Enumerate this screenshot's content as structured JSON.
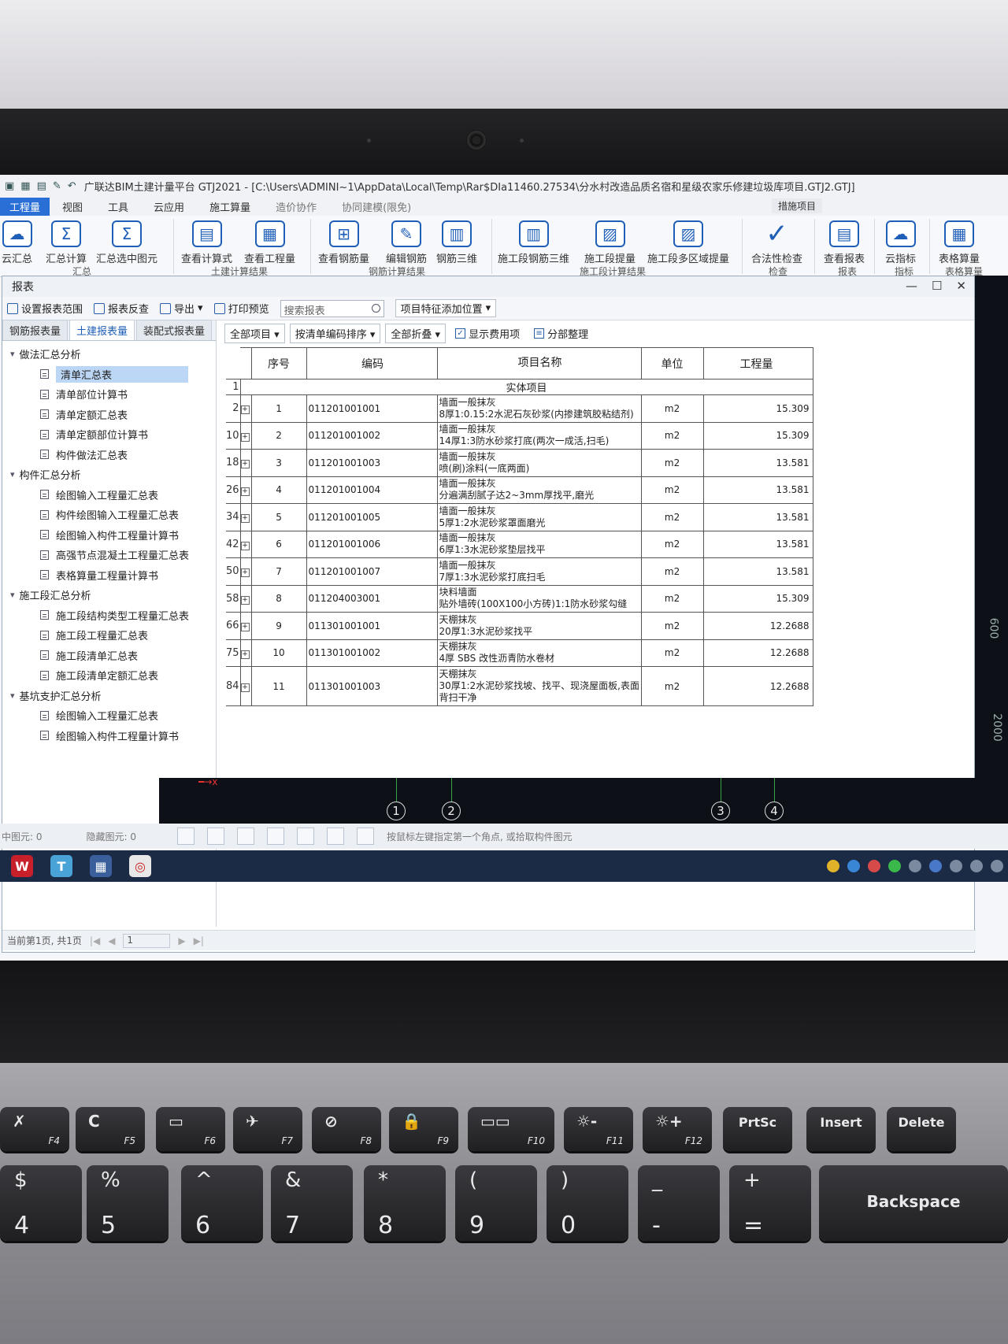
{
  "app": {
    "title": "广联达BIM土建计量平台 GTJ2021 - [C:\\Users\\ADMINI~1\\AppData\\Local\\Temp\\Rar$DIa11460.27534\\分水村改造品质名宿和星级农家乐修建垃圾库项目.GTJ2.GTJ]",
    "context_tab": "措施项目"
  },
  "menu": [
    "工程量",
    "视图",
    "工具",
    "云应用",
    "施工算量",
    "造价协作",
    "协同建模(限免)"
  ],
  "ribbon": {
    "buttons": [
      "云汇总",
      "汇总计算",
      "汇总选中图元",
      "查看计算式",
      "查看工程量",
      "查看钢筋量",
      "编辑钢筋",
      "钢筋三维",
      "施工段钢筋三维",
      "施工段提量",
      "施工段多区域提量",
      "合法性检查",
      "查看报表",
      "云指标",
      "表格算量"
    ],
    "groups": [
      "汇总",
      "土建计算结果",
      "钢筋计算结果",
      "施工段计算结果",
      "检查",
      "报表",
      "指标",
      "表格算量"
    ]
  },
  "report": {
    "title": "报表",
    "toolbar": {
      "set_range": "设置报表范围",
      "recheck": "报表反查",
      "export": "导出",
      "print_preview": "打印预览",
      "search_placeholder": "搜索报表",
      "feature_position": "项目特征添加位置"
    },
    "left_tabs": [
      "钢筋报表量",
      "土建报表量",
      "装配式报表量"
    ],
    "tree": [
      {
        "group": "做法汇总分析",
        "items": [
          "清单汇总表",
          "清单部位计算书",
          "清单定额汇总表",
          "清单定额部位计算书",
          "构件做法汇总表"
        ]
      },
      {
        "group": "构件汇总分析",
        "items": [
          "绘图输入工程量汇总表",
          "构件绘图输入工程量汇总表",
          "绘图输入构件工程量计算书",
          "高强节点混凝土工程量汇总表",
          "表格算量工程量计算书"
        ]
      },
      {
        "group": "施工段汇总分析",
        "items": [
          "施工段结构类型工程量汇总表",
          "施工段工程量汇总表",
          "施工段清单汇总表",
          "施工段清单定额汇总表"
        ]
      },
      {
        "group": "基坑支护汇总分析",
        "items": [
          "绘图输入工程量汇总表",
          "绘图输入构件工程量计算书"
        ]
      }
    ],
    "filter": {
      "scope": "全部项目",
      "sort": "按清单编码排序",
      "fold": "全部折叠",
      "show_fees": "显示费用项",
      "section": "分部整理"
    },
    "table": {
      "headers": [
        "序号",
        "编码",
        "项目名称",
        "单位",
        "工程量"
      ],
      "category_row": {
        "rownum": "1",
        "label": "实体项目"
      },
      "rows": [
        {
          "rownum": "2",
          "seq": "1",
          "code": "011201001001",
          "name1": "墙面一般抹灰",
          "name2": "8厚1:0.15:2水泥石灰砂浆(内掺建筑胶粘结剂)",
          "unit": "m2",
          "qty": "15.309"
        },
        {
          "rownum": "10",
          "seq": "2",
          "code": "011201001002",
          "name1": "墙面一般抹灰",
          "name2": "14厚1:3防水砂浆打底(两次一成活,扫毛)",
          "unit": "m2",
          "qty": "15.309"
        },
        {
          "rownum": "18",
          "seq": "3",
          "code": "011201001003",
          "name1": "墙面一般抹灰",
          "name2": "喷(刷)涂料(一底两面)",
          "unit": "m2",
          "qty": "13.581"
        },
        {
          "rownum": "26",
          "seq": "4",
          "code": "011201001004",
          "name1": "墙面一般抹灰",
          "name2": "分遍满刮腻子达2~3mm厚找平,磨光",
          "unit": "m2",
          "qty": "13.581"
        },
        {
          "rownum": "34",
          "seq": "5",
          "code": "011201001005",
          "name1": "墙面一般抹灰",
          "name2": "5厚1:2水泥砂浆罩面磨光",
          "unit": "m2",
          "qty": "13.581"
        },
        {
          "rownum": "42",
          "seq": "6",
          "code": "011201001006",
          "name1": "墙面一般抹灰",
          "name2": "6厚1:3水泥砂浆垫层找平",
          "unit": "m2",
          "qty": "13.581"
        },
        {
          "rownum": "50",
          "seq": "7",
          "code": "011201001007",
          "name1": "墙面一般抹灰",
          "name2": "7厚1:3水泥砂浆打底扫毛",
          "unit": "m2",
          "qty": "13.581"
        },
        {
          "rownum": "58",
          "seq": "8",
          "code": "011204003001",
          "name1": "块料墙面",
          "name2": "贴外墙砖(100X100小方砖)1:1防水砂浆勾缝",
          "unit": "m2",
          "qty": "15.309"
        },
        {
          "rownum": "66",
          "seq": "9",
          "code": "011301001001",
          "name1": "天棚抹灰",
          "name2": "20厚1:3水泥砂浆找平",
          "unit": "m2",
          "qty": "12.2688"
        },
        {
          "rownum": "75",
          "seq": "10",
          "code": "011301001002",
          "name1": "天棚抹灰",
          "name2": "4厚 SBS 改性沥青防水卷材",
          "unit": "m2",
          "qty": "12.2688"
        },
        {
          "rownum": "84",
          "seq": "11",
          "code": "011301001003",
          "name1": "天棚抹灰",
          "name2": "30厚1:2水泥砂浆找坡、找平、现浇屋面板,表面背扫干净",
          "unit": "m2",
          "qty": "12.2688"
        }
      ]
    },
    "pager": {
      "text": "当前第1页, 共1页",
      "page": "1"
    }
  },
  "cad": {
    "axes": [
      "1",
      "2",
      "3",
      "4"
    ],
    "dims": [
      "600",
      "2000",
      "600"
    ]
  },
  "status": {
    "selected": "中图元: 0",
    "hidden": "隐藏图元: 0",
    "hint": "按鼠标左键指定第一个角点, 或拾取构件图元"
  },
  "keyboard": {
    "fn_row": [
      {
        "sym": "✗",
        "fn": "F4"
      },
      {
        "sym": "C",
        "fn": "F5"
      },
      {
        "sym": "▭",
        "fn": "F6"
      },
      {
        "sym": "✈",
        "fn": "F7"
      },
      {
        "sym": "⊘",
        "fn": "F8"
      },
      {
        "sym": "🔒",
        "fn": "F9"
      },
      {
        "sym": "▭▭",
        "fn": "F10"
      },
      {
        "sym": "☼-",
        "fn": "F11"
      },
      {
        "sym": "☼+",
        "fn": "F12"
      },
      {
        "sym": "PrtSc",
        "fn": ""
      },
      {
        "sym": "Insert",
        "fn": ""
      },
      {
        "sym": "Delete",
        "fn": ""
      }
    ],
    "num_row": [
      {
        "top": "$",
        "bot": "4"
      },
      {
        "top": "%",
        "bot": "5"
      },
      {
        "top": "^",
        "bot": "6"
      },
      {
        "top": "&",
        "bot": "7"
      },
      {
        "top": "*",
        "bot": "8"
      },
      {
        "top": "(",
        "bot": "9"
      },
      {
        "top": ")",
        "bot": "0"
      },
      {
        "top": "_",
        "bot": "-"
      },
      {
        "top": "+",
        "bot": "="
      },
      {
        "top": "Backspace",
        "bot": ""
      }
    ]
  }
}
